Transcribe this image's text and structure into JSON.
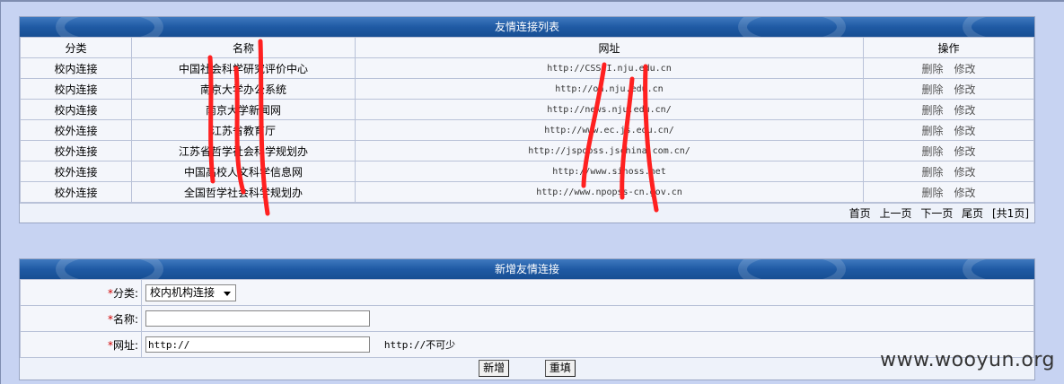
{
  "list_panel": {
    "title": "友情连接列表",
    "columns": [
      "分类",
      "名称",
      "网址",
      "操作"
    ],
    "rows": [
      {
        "category": "校内连接",
        "name": "中国社会科学研究评价中心",
        "url": "http://CSSCI.nju.edu.cn",
        "delete": "删除",
        "edit": "修改"
      },
      {
        "category": "校内连接",
        "name": "南京大学办公系统",
        "url": "http://oa.nju.edu.cn",
        "delete": "删除",
        "edit": "修改"
      },
      {
        "category": "校内连接",
        "name": "南京大学新闻网",
        "url": "http://news.nju.edu.cn/",
        "delete": "删除",
        "edit": "修改"
      },
      {
        "category": "校外连接",
        "name": "江苏省教育厅",
        "url": "http://www.ec.js.edu.cn/",
        "delete": "删除",
        "edit": "修改"
      },
      {
        "category": "校外连接",
        "name": "江苏省哲学社会科学规划办",
        "url": "http://jspopss.jschina.com.cn/",
        "delete": "删除",
        "edit": "修改"
      },
      {
        "category": "校外连接",
        "name": "中国高校人文科学信息网",
        "url": "http://www.sinoss.net",
        "delete": "删除",
        "edit": "修改"
      },
      {
        "category": "校外连接",
        "name": "全国哲学社会科学规划办",
        "url": "http://www.npopss-cn.gov.cn",
        "delete": "删除",
        "edit": "修改"
      }
    ],
    "pager": {
      "first": "首页",
      "prev": "上一页",
      "next": "下一页",
      "last": "尾页",
      "total": "[共1页]"
    }
  },
  "add_panel": {
    "title": "新增友情连接",
    "required_mark": "*",
    "category_label": "分类:",
    "category_value": "校内机构连接",
    "name_label": "名称:",
    "name_value": "",
    "url_label": "网址:",
    "url_value": "http://",
    "url_hint": "http://不可少",
    "submit_label": "新增",
    "reset_label": "重填"
  },
  "watermark": "www.wooyun.org",
  "colors": {
    "title_bar": "#1f5aa4",
    "background": "#c7d3f2",
    "required": "#d00000",
    "scribble": "#ff2020"
  }
}
